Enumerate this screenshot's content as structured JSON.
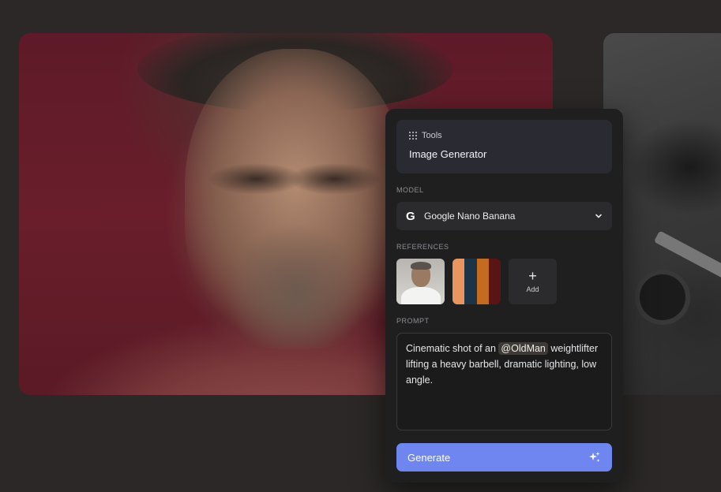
{
  "panel": {
    "tools_label": "Tools",
    "title": "Image Generator",
    "model_section_label": "MODEL",
    "model": {
      "icon": "google-g-icon",
      "name": "Google Nano Banana"
    },
    "references_section_label": "REFERENCES",
    "references": {
      "palette_colors": [
        "#e8955f",
        "#1d3446",
        "#c46b1f",
        "#5a1414"
      ],
      "add_label": "Add"
    },
    "prompt_section_label": "PROMPT",
    "prompt": {
      "before_mention": "Cinematic shot of an ",
      "mention": "@OldMan",
      "after_mention": " weightlifter lifting a heavy barbell, dramatic lighting, low angle."
    },
    "generate_label": "Generate"
  },
  "colors": {
    "accent": "#6f86f0",
    "panel_bg": "#1f1f20",
    "page_bg": "#2b2827"
  }
}
